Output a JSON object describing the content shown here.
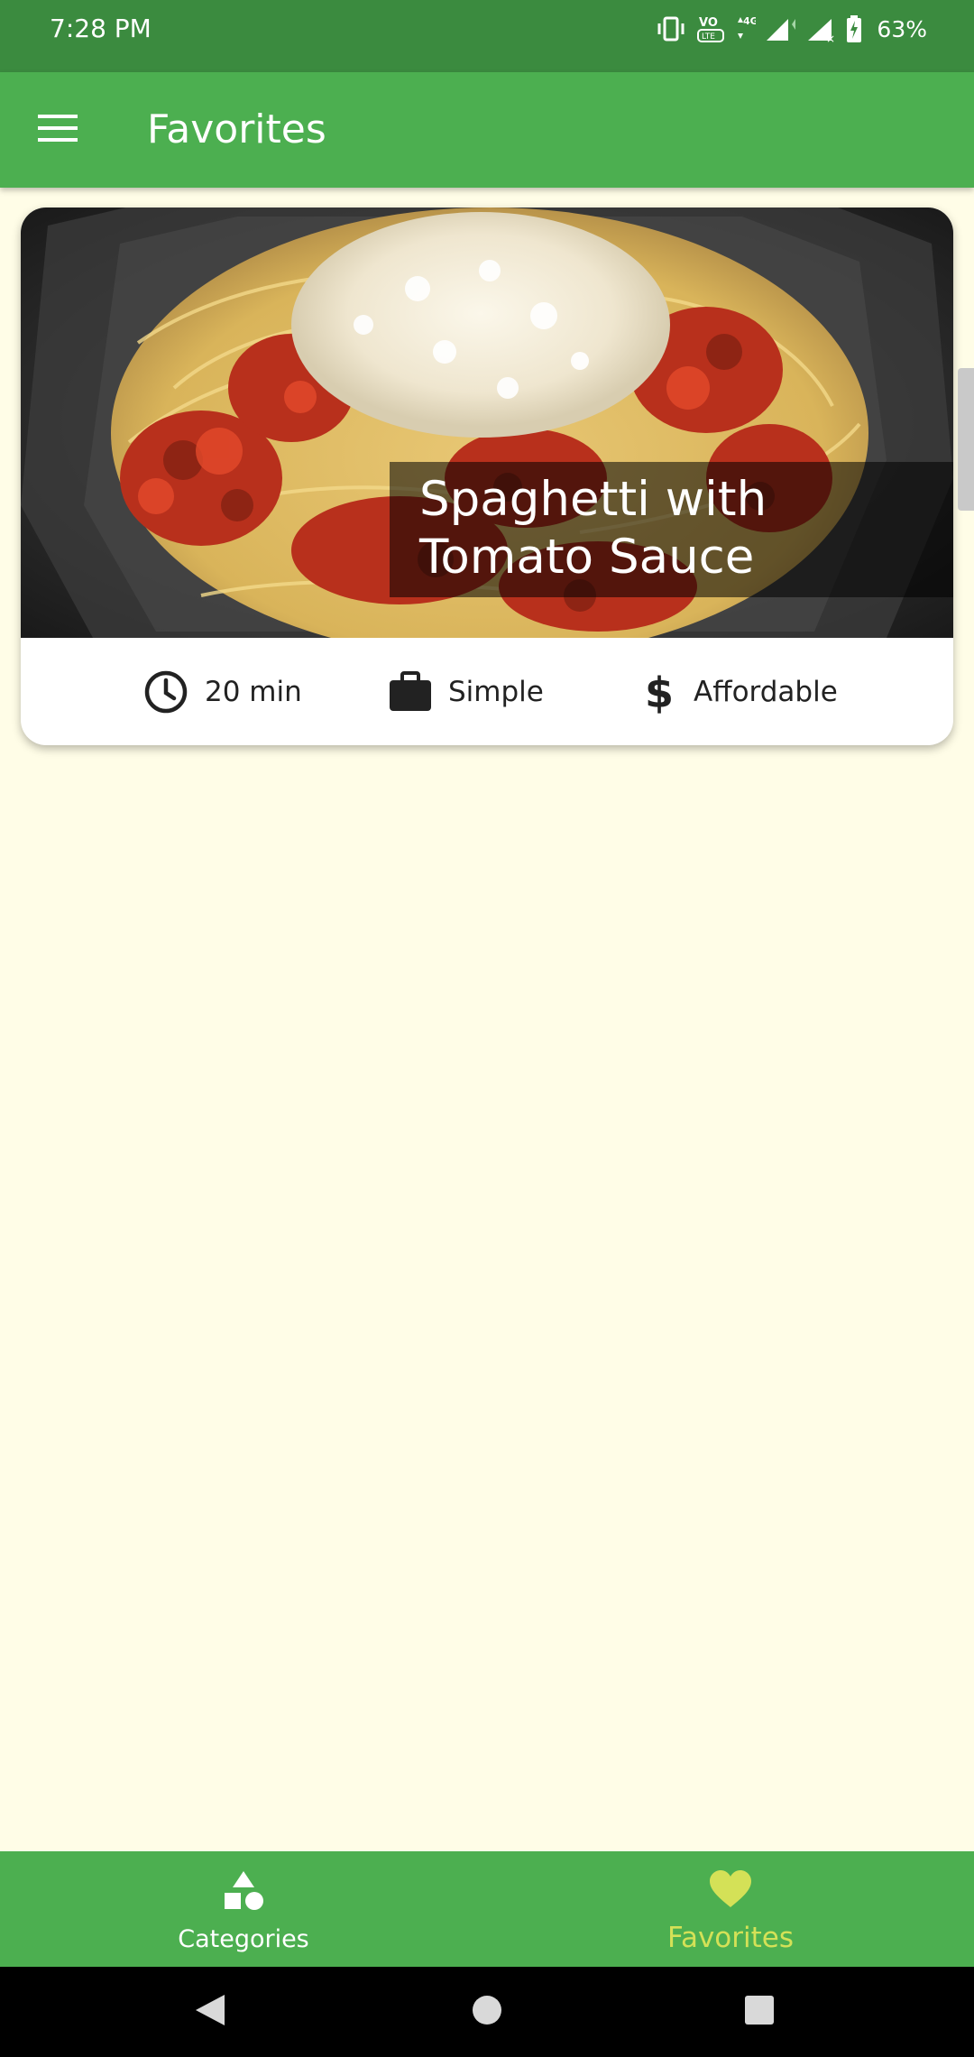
{
  "status_bar": {
    "time": "7:28 PM",
    "battery": "63%",
    "icons": [
      "vibrate-icon",
      "volte-icon",
      "network-4g-icon",
      "signal-icon",
      "signal-no-sim-icon",
      "battery-charging-icon"
    ]
  },
  "app_bar": {
    "title": "Favorites",
    "menu_icon": "menu-icon"
  },
  "meal": {
    "title": "Spaghetti with\nTomato Sauce",
    "duration": "20 min",
    "complexity": "Simple",
    "affordability": "Affordable",
    "duration_icon": "clock-icon",
    "complexity_icon": "briefcase-icon",
    "affordability_icon": "dollar-icon"
  },
  "bottom_nav": {
    "tabs": [
      {
        "label": "Categories",
        "icon": "category-shapes-icon",
        "active": false
      },
      {
        "label": "Favorites",
        "icon": "heart-icon",
        "active": true
      }
    ]
  },
  "system_nav": [
    "back-icon",
    "home-icon",
    "recents-icon"
  ],
  "colors": {
    "status_bar": "#3b8b3f",
    "primary": "#4caf50",
    "background": "#fffde7",
    "active_tab": "#d4e157",
    "inactive_tab": "#ffffff"
  }
}
